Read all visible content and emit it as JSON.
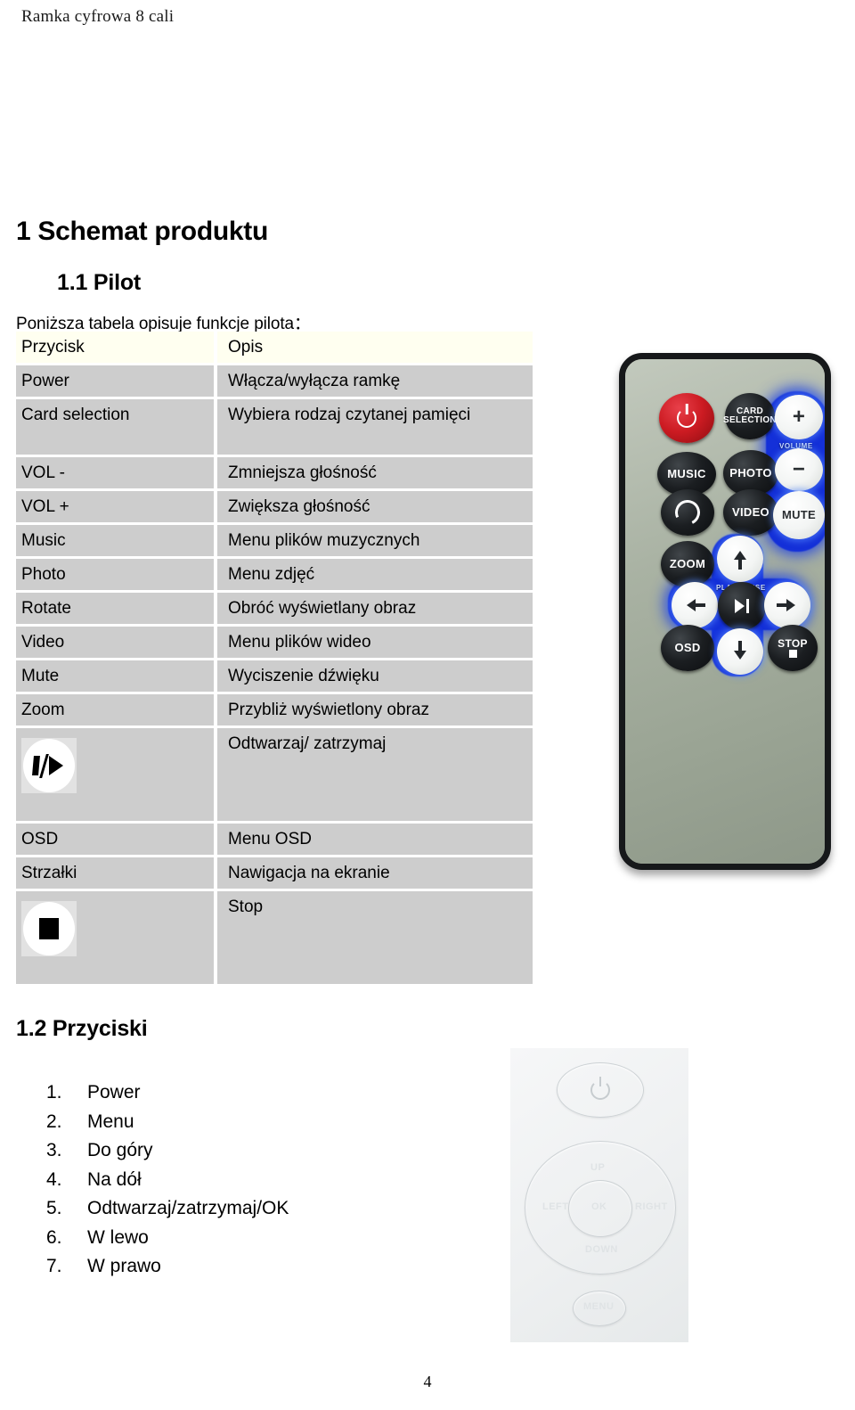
{
  "document": {
    "running_header": "Ramka cyfrowa 8 cali",
    "page_number": "4"
  },
  "section_1": {
    "heading": "1 Schemat produktu",
    "sub_1_1": {
      "heading": "1.1 Pilot",
      "intro": "Poniższa tabela opisuje funkcje pilota："
    },
    "sub_1_2": {
      "heading": "1.2 Przyciski"
    }
  },
  "remote_table": {
    "columns": {
      "key": "Przycisk",
      "description": "Opis"
    },
    "rows": [
      {
        "key": "Power",
        "desc": "Włącza/wyłącza ramkę",
        "size": "normal",
        "icon": ""
      },
      {
        "key": "Card selection",
        "desc": "Wybiera rodzaj czytanej pamięci",
        "size": "tall",
        "icon": ""
      },
      {
        "key": "VOL -",
        "desc": "Zmniejsza głośność",
        "size": "normal",
        "icon": ""
      },
      {
        "key": "VOL +",
        "desc": "Zwiększa głośność",
        "size": "normal",
        "icon": ""
      },
      {
        "key": "Music",
        "desc": "Menu plików muzycznych",
        "size": "normal",
        "icon": ""
      },
      {
        "key": "Photo",
        "desc": "Menu zdjęć",
        "size": "normal",
        "icon": ""
      },
      {
        "key": "Rotate",
        "desc": "Obróć wyświetlany obraz",
        "size": "normal",
        "icon": ""
      },
      {
        "key": "Video",
        "desc": "Menu plików wideo",
        "size": "normal",
        "icon": ""
      },
      {
        "key": "Mute",
        "desc": "Wyciszenie dźwięku",
        "size": "normal",
        "icon": ""
      },
      {
        "key": "Zoom",
        "desc": "Przybliż wyświetlony obraz",
        "size": "normal",
        "icon": ""
      },
      {
        "key": "",
        "desc": "Odtwarzaj/ zatrzymaj",
        "size": "icon",
        "icon": "play-pause-icon"
      },
      {
        "key": "OSD",
        "desc": "Menu OSD",
        "size": "normal",
        "icon": ""
      },
      {
        "key": "Strzałki",
        "desc": "Nawigacja na ekranie",
        "size": "normal",
        "icon": ""
      },
      {
        "key": "",
        "desc": "Stop",
        "size": "icon",
        "icon": "stop-icon"
      }
    ]
  },
  "buttons_list": [
    {
      "num": "1.",
      "label": "Power"
    },
    {
      "num": "2.",
      "label": "Menu"
    },
    {
      "num": "3.",
      "label": "Do góry"
    },
    {
      "num": "4.",
      "label": "Na dół"
    },
    {
      "num": "5.",
      "label": "Odtwarzaj/zatrzymaj/OK"
    },
    {
      "num": "6.",
      "label": "W lewo"
    },
    {
      "num": "7.",
      "label": "W prawo"
    }
  ],
  "remote_photo": {
    "alt": "Zdjęcie pilota",
    "body_color": "#a9b2a3",
    "bezel_color": "#16181a",
    "power_button_color": "#cc1b22",
    "glow_color": "#1430d8",
    "buttons": {
      "power": "",
      "card_selection": "CARD\nSELECTION",
      "volume_plus": "+",
      "volume_label": "VOLUME",
      "music": "MUSIC",
      "photo": "PHOTO",
      "volume_minus": "−",
      "rotate_label": "ROTATE",
      "video": "VIDEO",
      "mute": "MUTE",
      "zoom": "ZOOM",
      "playpause_label": "PLAY/PAUSE",
      "osd": "OSD",
      "stop": "STOP"
    }
  },
  "device_photo": {
    "alt": "Zdjęcie przycisków ramki",
    "faint_labels": {
      "up": "UP",
      "left": "LEFT",
      "ok": "OK",
      "right": "RIGHT",
      "down": "DOWN",
      "menu": "MENU"
    }
  }
}
